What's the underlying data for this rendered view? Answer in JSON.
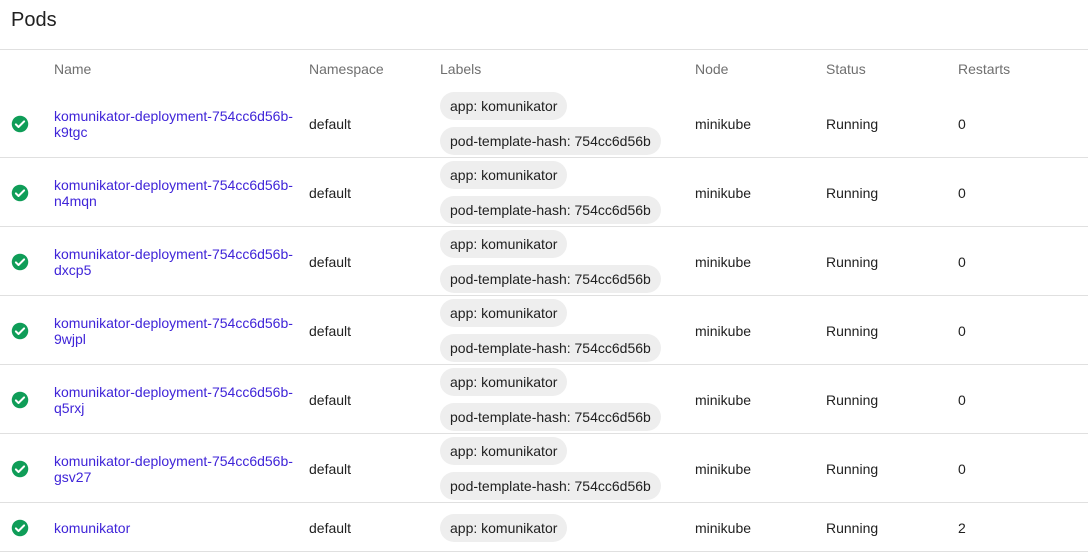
{
  "page": {
    "title": "Pods"
  },
  "table": {
    "columns": {
      "name": "Name",
      "namespace": "Namespace",
      "labels": "Labels",
      "node": "Node",
      "status": "Status",
      "restarts": "Restarts"
    },
    "rows": [
      {
        "name": [
          "komunikator-deployment-754cc6d56b-",
          "k9tgc"
        ],
        "namespace": "default",
        "labels": [
          "app: komunikator",
          "pod-template-hash: 754cc6d56b"
        ],
        "node": "minikube",
        "status": "Running",
        "restarts": "0"
      },
      {
        "name": [
          "komunikator-deployment-754cc6d56b-",
          "n4mqn"
        ],
        "namespace": "default",
        "labels": [
          "app: komunikator",
          "pod-template-hash: 754cc6d56b"
        ],
        "node": "minikube",
        "status": "Running",
        "restarts": "0"
      },
      {
        "name": [
          "komunikator-deployment-754cc6d56b-",
          "dxcp5"
        ],
        "namespace": "default",
        "labels": [
          "app: komunikator",
          "pod-template-hash: 754cc6d56b"
        ],
        "node": "minikube",
        "status": "Running",
        "restarts": "0"
      },
      {
        "name": [
          "komunikator-deployment-754cc6d56b-",
          "9wjpl"
        ],
        "namespace": "default",
        "labels": [
          "app: komunikator",
          "pod-template-hash: 754cc6d56b"
        ],
        "node": "minikube",
        "status": "Running",
        "restarts": "0"
      },
      {
        "name": [
          "komunikator-deployment-754cc6d56b-",
          "q5rxj"
        ],
        "namespace": "default",
        "labels": [
          "app: komunikator",
          "pod-template-hash: 754cc6d56b"
        ],
        "node": "minikube",
        "status": "Running",
        "restarts": "0"
      },
      {
        "name": [
          "komunikator-deployment-754cc6d56b-",
          "gsv27"
        ],
        "namespace": "default",
        "labels": [
          "app: komunikator",
          "pod-template-hash: 754cc6d56b"
        ],
        "node": "minikube",
        "status": "Running",
        "restarts": "0"
      },
      {
        "name": [
          "komunikator"
        ],
        "namespace": "default",
        "labels": [
          "app: komunikator"
        ],
        "node": "minikube",
        "status": "Running",
        "restarts": "2"
      }
    ]
  },
  "icons": {
    "status": "check-circle-icon"
  },
  "colors": {
    "status_ok": "#0f9d58",
    "link": "#3f24d8",
    "chip_bg": "#eeeeee",
    "divider": "#e0e0e0"
  }
}
